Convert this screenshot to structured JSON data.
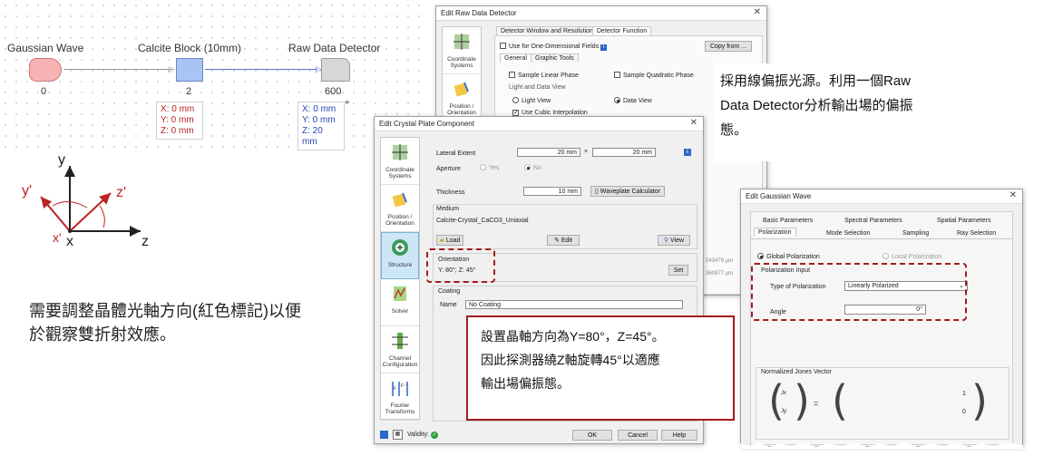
{
  "setup": {
    "gaussian": {
      "label": "Gaussian Wave",
      "index": "0"
    },
    "calcite": {
      "label": "Calcite Block (10mm)",
      "index": "2",
      "pos": [
        "X: 0 mm",
        "Y: 0 mm",
        "Z: 0 mm"
      ]
    },
    "detector": {
      "label": "Raw Data Detector",
      "index": "600",
      "pos": [
        "X: 0 mm",
        "Y: 0 mm",
        "Z: 20 mm"
      ]
    }
  },
  "axes": {
    "y": "y",
    "yp": "y'",
    "zp": "z'",
    "x": "x",
    "xp": "x'",
    "xx": "x",
    "z": "z"
  },
  "note_left": "需要調整晶體光軸方向(紅色標記)以便於觀察雙折射效應。",
  "note_right": "採用線偏振光源。利用一個Raw Data Detector分析輸出場的偏振態。",
  "callout": {
    "line1": "設置晶軸方向為Y=80°，Z=45°。",
    "line2": "因此探測器繞Z軸旋轉45°以適應",
    "line3": "輸出場偏振態。"
  },
  "raw_dialog": {
    "title": "Edit Raw Data Detector",
    "close": "✕",
    "tabs": [
      "Detector Window and Resolution",
      "Detector Function"
    ],
    "use_1d": "Use for One-Dimensional Fields",
    "copy_from": "Copy from ...",
    "subtabs": [
      "General",
      "Graphic Tools"
    ],
    "sample_linear": "Sample Linear Phase",
    "sample_quad": "Sample Quadratic Phase",
    "light_data_view": "Light and Data View",
    "light_view": "Light View",
    "data_view": "Data View",
    "cubic": "Use Cubic Interpolation",
    "side": [
      "Coordinate Systems",
      "Position / Orientation"
    ],
    "hidden_vals": [
      "543479 µm",
      "360977 µm"
    ]
  },
  "crystal_dialog": {
    "title": "Edit Crystal Plate Component",
    "close": "✕",
    "side": [
      "Coordinate Systems",
      "Position / Orientation",
      "Structure",
      "Solver",
      "Channel Configuration",
      "Fourier Transforms"
    ],
    "lateral_extent": "Lateral Extent",
    "lat_x": "20 mm",
    "times": "×",
    "lat_y": "20 mm",
    "aperture": "Aperture",
    "yes": "Yes",
    "no": "No",
    "thickness": "Thickness",
    "thickness_val": "10 mm",
    "waveplate": "Waveplate Calculator",
    "medium": "Medium",
    "medium_val": "Calcite-Crystal_CaCO3_Uniaxial",
    "load": "Load",
    "edit": "Edit",
    "view": "View",
    "orientation": "Orientation",
    "orientation_val": "Y: 80°; Z: 45°",
    "set": "Set",
    "coating": "Coating",
    "name": "Name",
    "coating_val": "No Coating",
    "validity": "Validity:",
    "ok": "OK",
    "cancel": "Cancel",
    "help": "Help"
  },
  "gauss_dialog": {
    "title": "Edit Gaussian Wave",
    "close": "✕",
    "tabs_row1": [
      "Basic Parameters",
      "Spectral Parameters",
      "Spatial Parameters"
    ],
    "tabs_row2": [
      "Polarization",
      "Mode Selection",
      "Sampling",
      "Ray Selection"
    ],
    "global_pol": "Global Polarization",
    "local_pol": "Local Polarization",
    "pol_input": "Polarization Input",
    "type_label": "Type of Polarization",
    "type_val": "Linearly Polarized",
    "angle_label": "Angle",
    "angle_val": "0°",
    "jones": "Normalized Jones Vector",
    "jx": "Jx",
    "jy": "Jy",
    "equals": "=",
    "v1": "1",
    "v2": "0"
  },
  "colors": {
    "accent_red": "#a31b1b",
    "pos_red": "#bb2222",
    "pos_blue": "#2547b8"
  }
}
